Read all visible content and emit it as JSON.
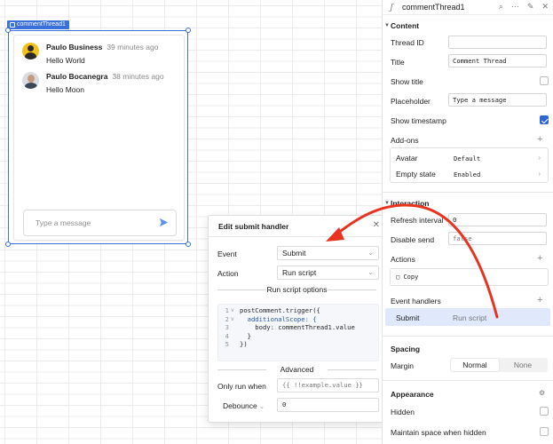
{
  "component": {
    "tag": "commentThread1",
    "comments": [
      {
        "author": "Paulo Business",
        "time": "39 minutes ago",
        "body": "Hello World",
        "avatar": "avatar-silhouette-yellow"
      },
      {
        "author": "Paulo Bocanegra",
        "time": "38 minutes ago",
        "body": "Hello Moon",
        "avatar": "avatar-photo"
      }
    ],
    "placeholder": "Type a message"
  },
  "modal": {
    "title": "Edit submit handler",
    "event_label": "Event",
    "event_value": "Submit",
    "action_label": "Action",
    "action_value": "Run script",
    "options_heading": "Run script options",
    "code_lines": [
      {
        "n": "1",
        "arrow": "v",
        "text": "postComment.trigger({"
      },
      {
        "n": "2",
        "arrow": "v",
        "text": "  additionalScope: {"
      },
      {
        "n": "3",
        "arrow": "",
        "text": "    body: commentThread1.value"
      },
      {
        "n": "4",
        "arrow": "",
        "text": "  }"
      },
      {
        "n": "5",
        "arrow": "",
        "text": "})"
      }
    ],
    "advanced_heading": "Advanced",
    "only_run_label": "Only run when",
    "only_run_value": "{{ !!example.value }}",
    "debounce_label": "Debounce",
    "debounce_value": "0"
  },
  "panel": {
    "title": "commentThread1",
    "content_heading": "Content",
    "thread_id_label": "Thread ID",
    "thread_id_value": "",
    "title_label": "Title",
    "title_value": "Comment Thread",
    "show_title_label": "Show title",
    "show_title_checked": false,
    "placeholder_label": "Placeholder",
    "placeholder_value": "Type a message",
    "show_timestamp_label": "Show timestamp",
    "show_timestamp_checked": true,
    "addons_label": "Add-ons",
    "addons": [
      {
        "name": "Avatar",
        "value": "Default"
      },
      {
        "name": "Empty state",
        "value": "Enabled"
      }
    ],
    "interaction_heading": "Interaction",
    "refresh_label": "Refresh interval",
    "refresh_value": "0",
    "disable_send_label": "Disable send",
    "disable_send_value": "false",
    "actions_label": "Actions",
    "copy_label": "Copy",
    "event_handlers_label": "Event handlers",
    "handler_event": "Submit",
    "handler_action": "Run script",
    "spacing_heading": "Spacing",
    "margin_label": "Margin",
    "margin_options": [
      "Normal",
      "None"
    ],
    "appearance_heading": "Appearance",
    "hidden_label": "Hidden",
    "maintain_label": "Maintain space when hidden"
  },
  "colors": {
    "accent": "#3b6fd9",
    "checkbox": "#2f66d6",
    "arrow": "#e8331e",
    "selected_row": "#dfe9fb"
  }
}
